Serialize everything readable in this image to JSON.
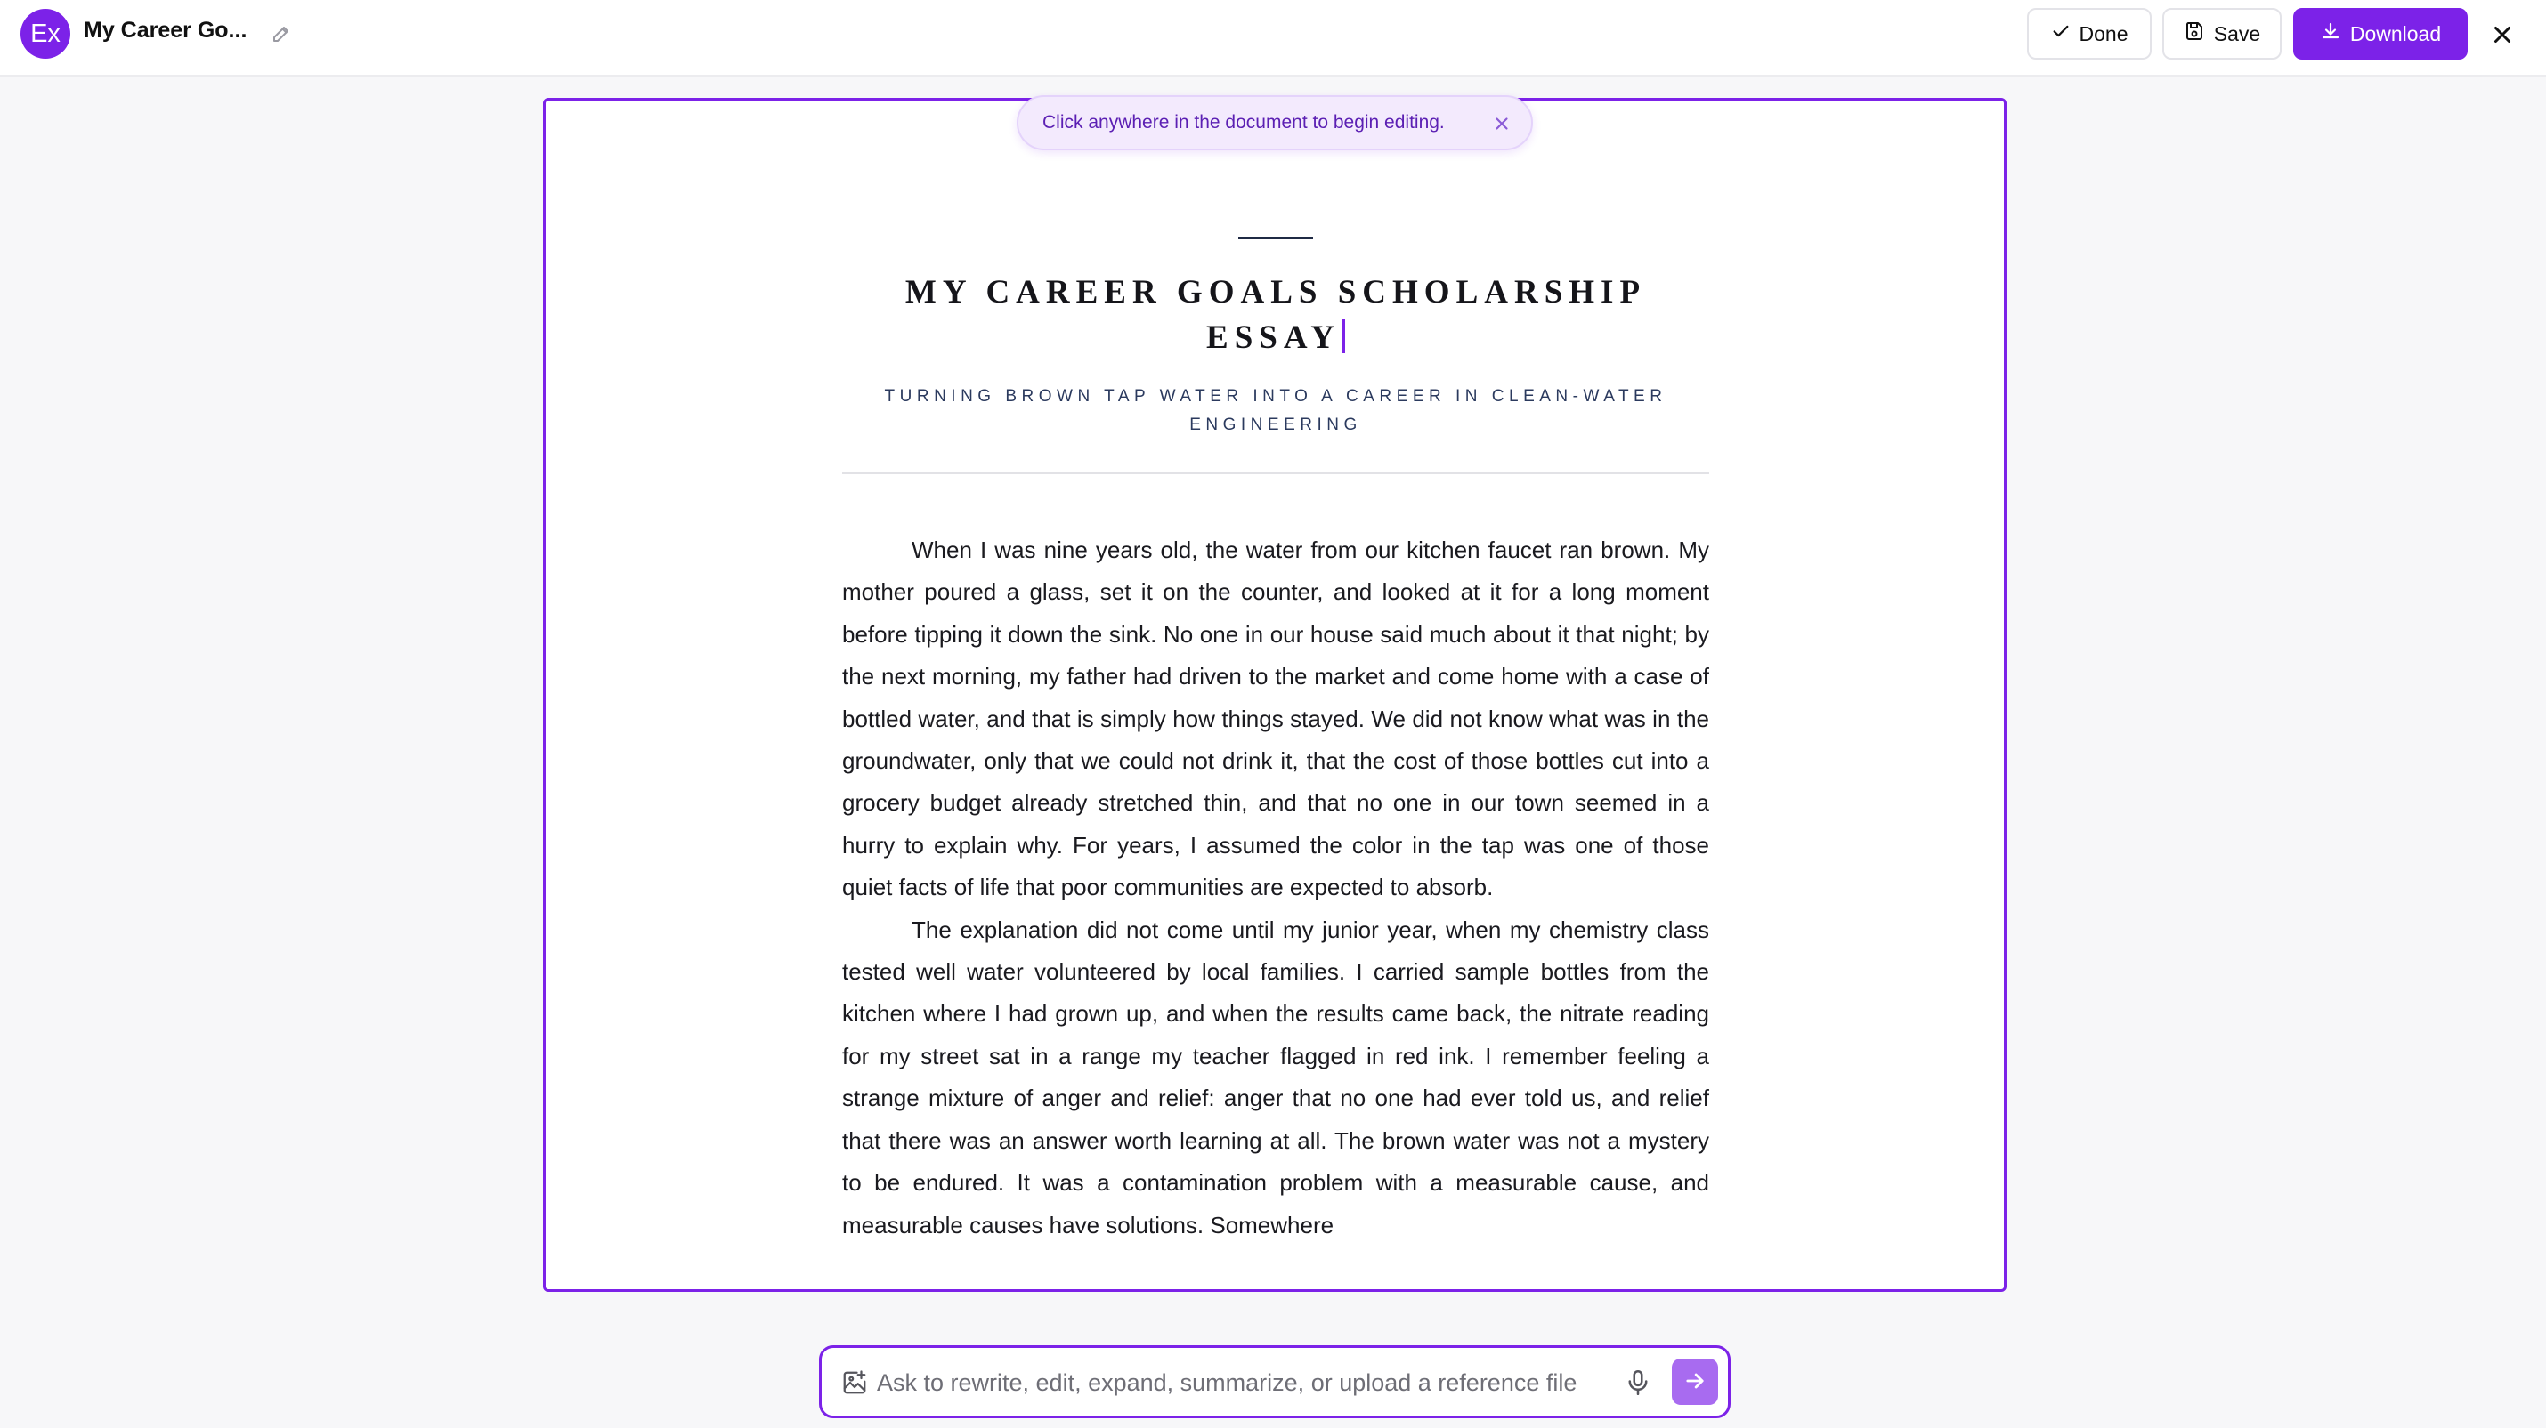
{
  "app": {
    "logo_text": "Ex",
    "doc_title": "My Career Go..."
  },
  "toolbar": {
    "done_label": "Done",
    "save_label": "Save",
    "download_label": "Download"
  },
  "hint": {
    "text": "Click anywhere in the document to begin editing."
  },
  "essay": {
    "title": "MY CAREER GOALS SCHOLARSHIP ESSAY",
    "subtitle": "TURNING BROWN TAP WATER INTO A CAREER IN CLEAN-WATER ENGINEERING",
    "paragraphs": [
      "When I was nine years old, the water from our kitchen faucet ran brown. My mother poured a glass, set it on the counter, and looked at it for a long moment before tipping it down the sink. No one in our house said much about it that night; by the next morning, my father had driven to the market and come home with a case of bottled water, and that is simply how things stayed. We did not know what was in the groundwater, only that we could not drink it, that the cost of those bottles cut into a grocery budget already stretched thin, and that no one in our town seemed in a hurry to explain why. For years, I assumed the color in the tap was one of those quiet facts of life that poor communities are expected to absorb.",
      "The explanation did not come until my junior year, when my chemistry class tested well water volunteered by local families. I carried sample bottles from the kitchen where I had grown up, and when the results came back, the nitrate reading for my street sat in a range my teacher flagged in red ink. I remember feeling a strange mixture of anger and relief: anger that no one had ever told us, and relief that there was an answer worth learning at all. The brown water was not a mystery to be endured. It was a contamination problem with a measurable cause, and measurable causes have solutions. Somewhere"
    ]
  },
  "prompt": {
    "placeholder": "Ask to rewrite, edit, expand, summarize, or upload a reference file"
  },
  "icons": {
    "rename": "pencil-icon",
    "done": "check-icon",
    "save": "save-icon",
    "download": "download-icon",
    "close": "close-icon",
    "hint_close": "close-icon",
    "attach": "image-plus-icon",
    "mic": "mic-icon",
    "send": "arrow-right-icon"
  },
  "colors": {
    "accent": "#7c22e8",
    "send_button": "#a86bf0",
    "hint_background": "#f3eafd",
    "hint_text": "#5b1fb3"
  }
}
